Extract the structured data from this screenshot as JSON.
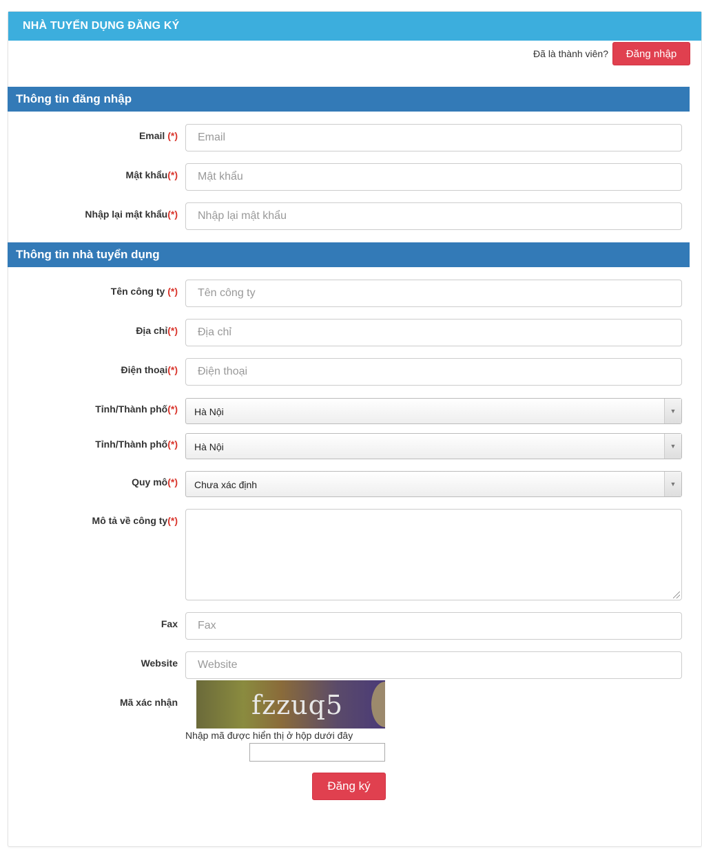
{
  "header": {
    "title": "NHÀ TUYỂN DỤNG ĐĂNG KÝ"
  },
  "member": {
    "text": "Đã là thành viên?",
    "login_label": "Đăng nhập"
  },
  "sections": {
    "login_info": "Thông tin đăng nhập",
    "employer_info": "Thông tin nhà tuyển dụng"
  },
  "required_mark": "(*)",
  "fields": {
    "email": {
      "label": "Email ",
      "placeholder": "Email"
    },
    "password": {
      "label": "Mật khẩu",
      "placeholder": "Mật khẩu"
    },
    "password_confirm": {
      "label": "Nhập lại mật khẩu",
      "placeholder": "Nhập lại mật khẩu"
    },
    "company": {
      "label": "Tên công ty ",
      "placeholder": "Tên công ty"
    },
    "address": {
      "label": "Địa chỉ",
      "placeholder": "Địa chỉ"
    },
    "phone": {
      "label": "Điện thoại",
      "placeholder": "Điện thoại"
    },
    "province1": {
      "label": "Tỉnh/Thành phố",
      "value": "Hà Nội"
    },
    "province2": {
      "label": "Tỉnh/Thành phố",
      "value": "Hà Nội"
    },
    "scale": {
      "label": "Quy mô",
      "value": "Chưa xác định"
    },
    "description": {
      "label": "Mô tả về công ty"
    },
    "fax": {
      "label": "Fax",
      "placeholder": "Fax"
    },
    "website": {
      "label": "Website",
      "placeholder": "Website"
    }
  },
  "captcha": {
    "label": "Mã xác nhận",
    "code": "fzzuq5",
    "hint": "Nhập mã được hiển thị ở hộp dưới đây"
  },
  "submit": {
    "label": "Đăng ký"
  },
  "colors": {
    "header": "#3caedd",
    "section": "#337ab7",
    "button": "#e0404f",
    "required": "#d9342b"
  }
}
